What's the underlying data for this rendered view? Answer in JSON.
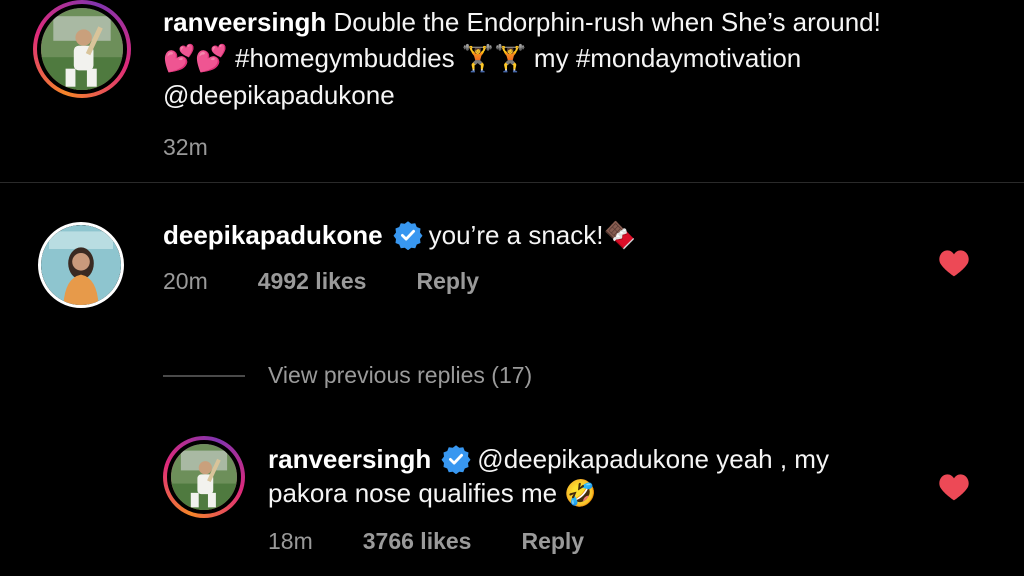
{
  "post": {
    "username": "ranveersingh",
    "caption_text": "Double the Endorphin-rush when She’s around!",
    "hashtag1": "#homegymbuddies",
    "caption_mid": "my",
    "hashtag2": "#mondaymotivation",
    "mention": "@deepikapadukone",
    "time": "32m",
    "emojis": {
      "hearts": "💕💕",
      "lifters": "🏋🏋"
    }
  },
  "comment": {
    "username": "deepikapadukone",
    "text": "you’re a snack!",
    "emoji": "🍫",
    "time": "20m",
    "likes": "4992 likes",
    "reply_label": "Reply"
  },
  "view_replies": "View previous replies (17)",
  "reply": {
    "username": "ranveersingh",
    "mention": "@deepikapadukone",
    "text_line1": "yeah , my",
    "text_line2": "pakora nose qualifies me",
    "emoji": "🤣",
    "time": "18m",
    "likes": "3766 likes",
    "reply_label": "Reply"
  },
  "colors": {
    "background": "#000000",
    "heart": "#ed4956",
    "verified": "#3897f0",
    "muted": "#9a9a9a"
  }
}
